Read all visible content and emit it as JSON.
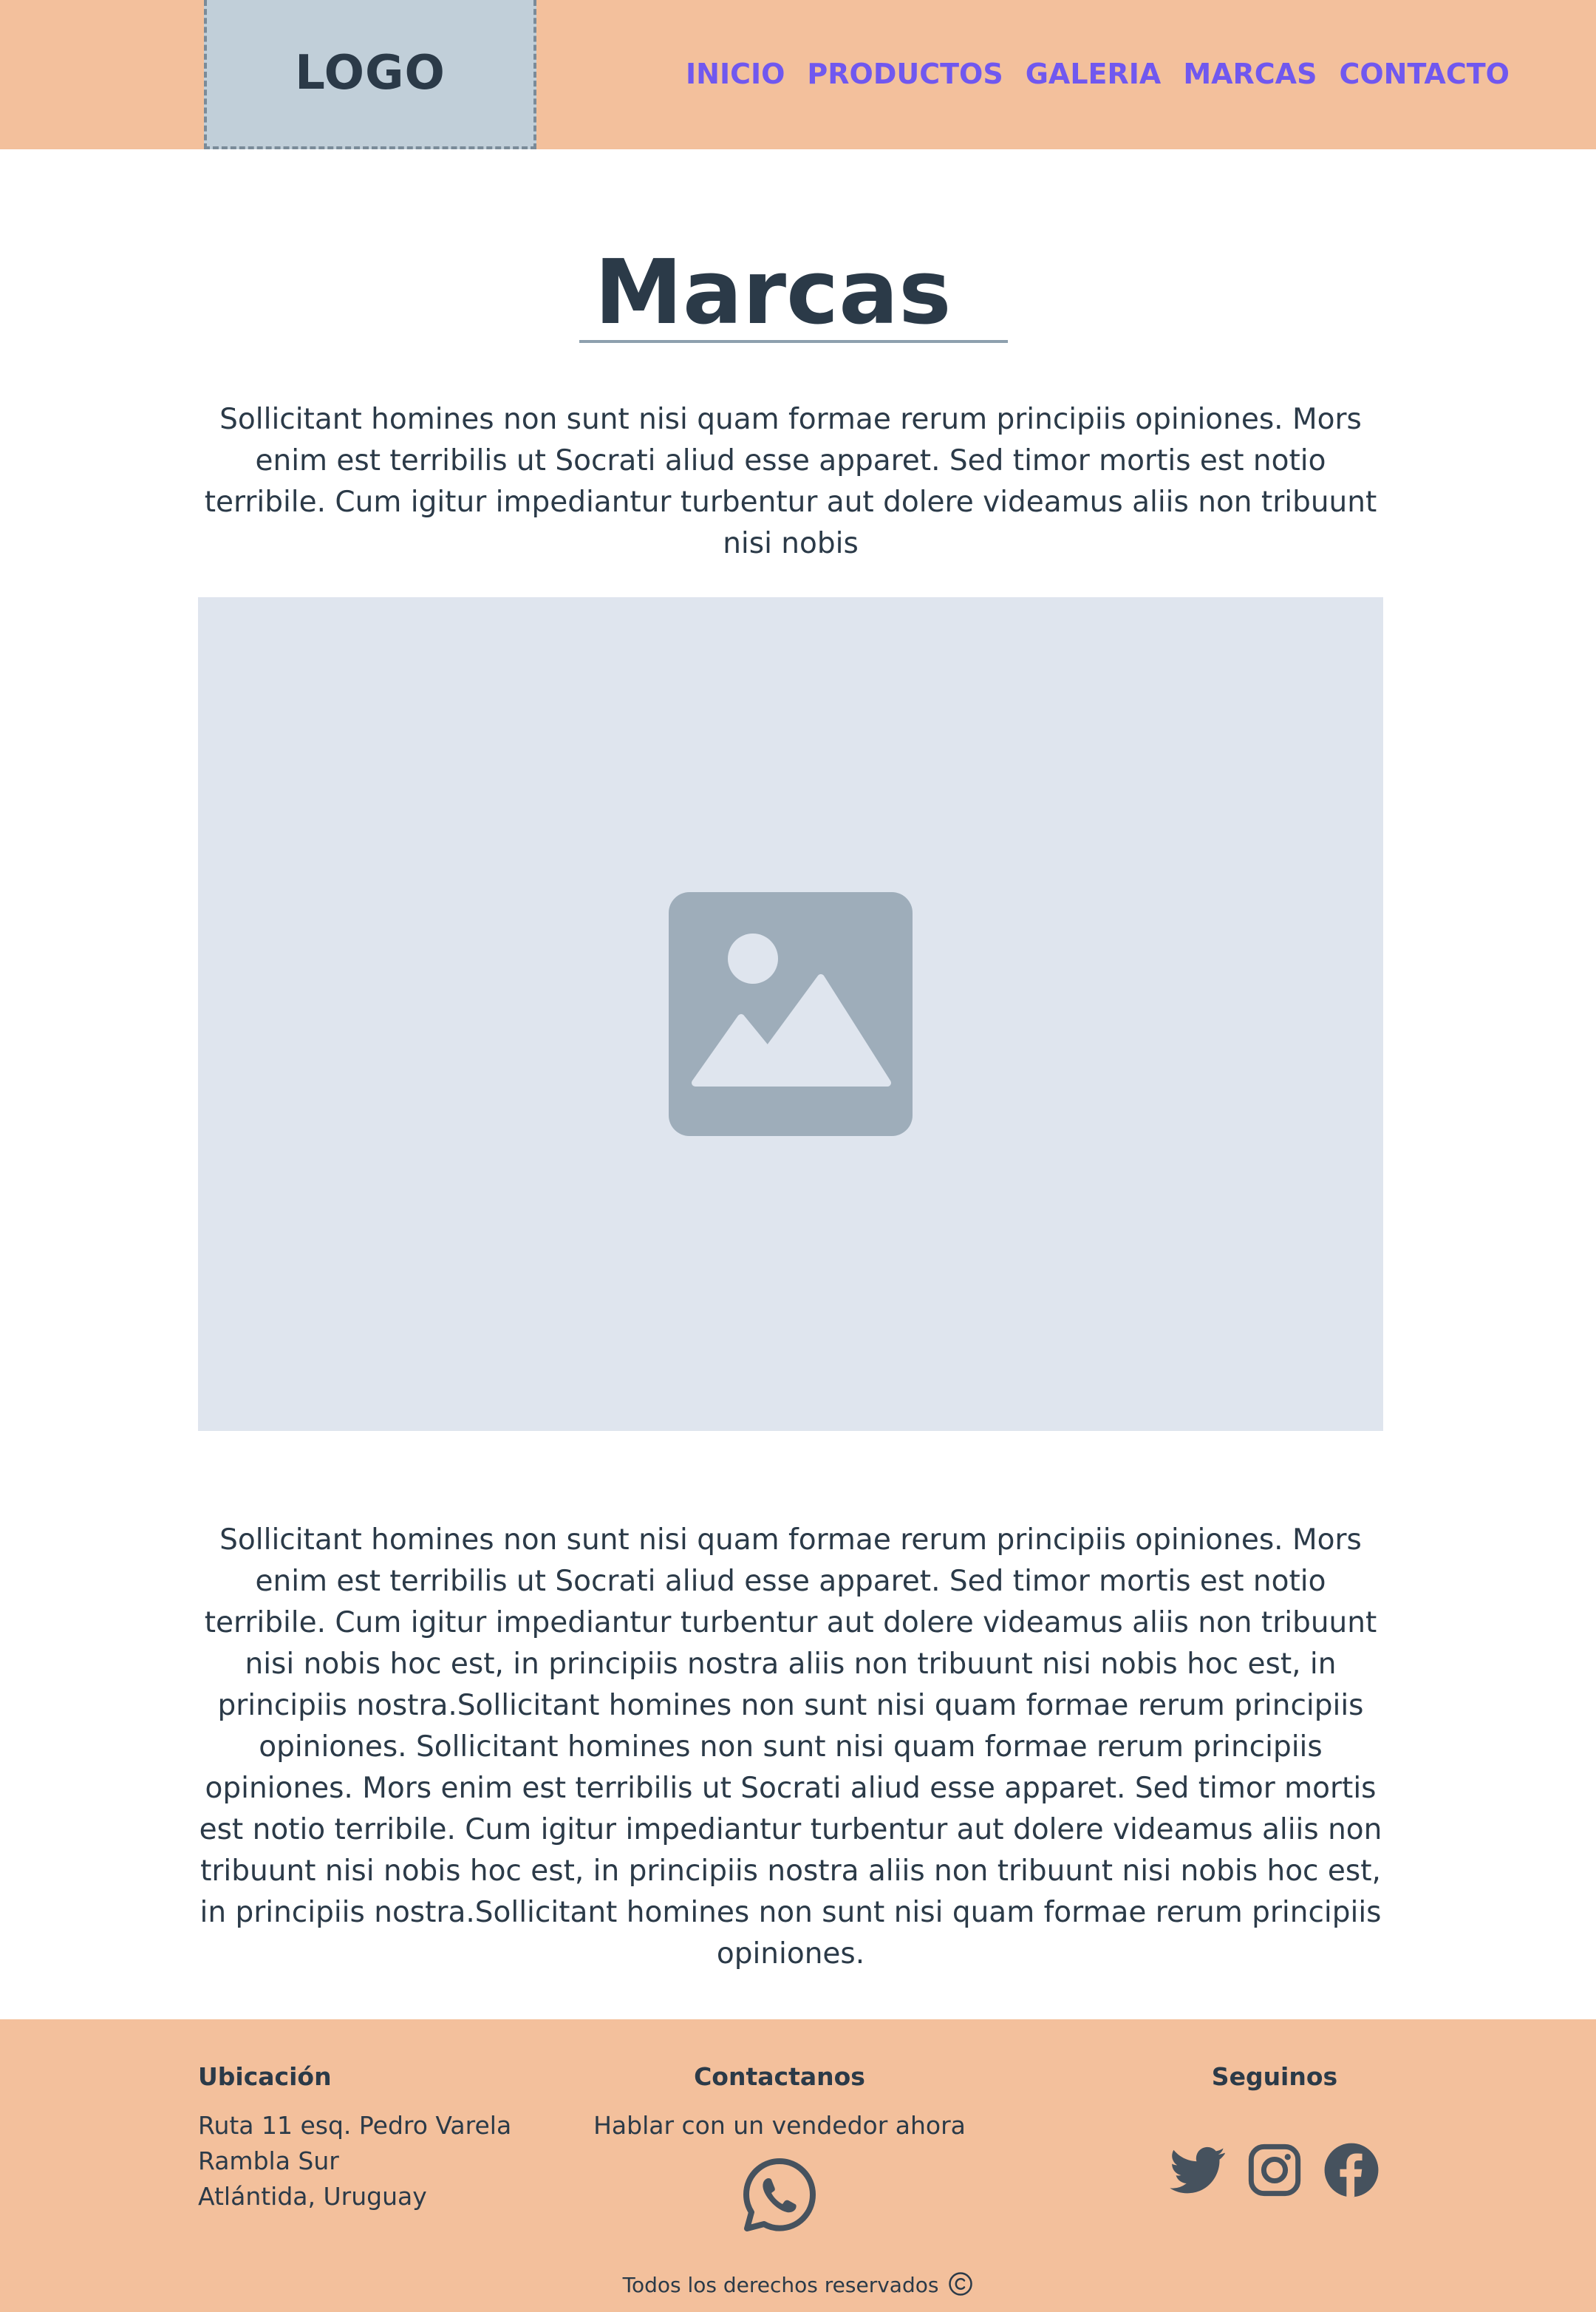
{
  "header": {
    "logo_text": "LOGO",
    "nav": [
      "INICIO",
      "PRODUCTOS",
      "GALERIA",
      "MARCAS",
      "CONTACTO"
    ]
  },
  "page": {
    "title": "Marcas",
    "intro": "Sollicitant homines non sunt nisi quam formae rerum principiis opiniones. Mors enim est terribilis ut Socrati aliud esse apparet. Sed timor mortis est notio terribile. Cum igitur impediantur turbentur aut dolere videamus aliis non tribuunt nisi nobis",
    "image_icon": "image-placeholder-icon",
    "body": "Sollicitant homines non sunt nisi quam formae rerum principiis opiniones. Mors enim est terribilis ut Socrati aliud esse apparet. Sed timor mortis est notio terribile. Cum igitur impediantur turbentur aut dolere videamus aliis non tribuunt nisi nobis hoc est, in principiis nostra aliis non tribuunt nisi nobis hoc est, in principiis nostra.Sollicitant homines non sunt nisi quam formae rerum principiis opiniones. Sollicitant homines non sunt nisi quam formae rerum principiis opiniones. Mors enim est terribilis ut Socrati aliud esse apparet. Sed timor mortis est notio terribile. Cum igitur impediantur turbentur aut dolere videamus aliis non tribuunt nisi nobis hoc est, in principiis nostra aliis non tribuunt nisi nobis hoc est, in principiis nostra.Sollicitant homines non sunt nisi quam formae rerum principiis opiniones."
  },
  "footer": {
    "location": {
      "heading": "Ubicación",
      "lines": [
        "Ruta 11 esq. Pedro Varela",
        "Rambla Sur",
        "Atlántida, Uruguay"
      ]
    },
    "contact": {
      "heading": "Contactanos",
      "text": "Hablar con un vendedor ahora",
      "icon": "whatsapp-icon"
    },
    "social": {
      "heading": "Seguinos",
      "icons": [
        "twitter-icon",
        "instagram-icon",
        "facebook-icon"
      ]
    },
    "copyright": "Todos los derechos reservados"
  },
  "colors": {
    "header_bg": "#f3c09c",
    "nav_link": "#7058ef",
    "text": "#2b3a48",
    "logo_bg": "#c1cfd9",
    "image_bg": "#dfe5ee",
    "image_icon": "#9eadba"
  }
}
